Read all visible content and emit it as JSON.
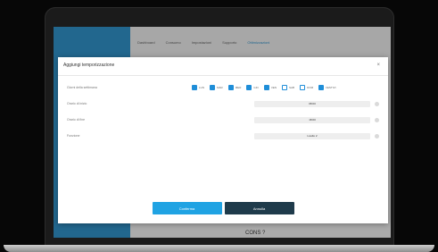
{
  "app": {
    "nav": [
      "Dashboard",
      "Consumo",
      "Impostazioni",
      "Supporto",
      "Ottimizzazioni"
    ],
    "active_nav": 4,
    "footer_text": "CONS ?"
  },
  "modal": {
    "title": "Aggiungi temporizzazione",
    "close_glyph": "×",
    "days_label": "Giorni della settimana",
    "days": [
      {
        "label": "LUN",
        "checked": true
      },
      {
        "label": "MAR",
        "checked": true
      },
      {
        "label": "MER",
        "checked": true
      },
      {
        "label": "GIO",
        "checked": true
      },
      {
        "label": "VEN",
        "checked": true
      },
      {
        "label": "SAB",
        "checked": false
      },
      {
        "label": "DOM",
        "checked": false
      },
      {
        "label": "FESTIVI",
        "checked": true
      }
    ],
    "fields": [
      {
        "label": "Orario di inizio",
        "value": "08:00"
      },
      {
        "label": "Orario di fine",
        "value": "18:00"
      },
      {
        "label": "Funzione",
        "value": "Livello 2"
      }
    ],
    "buttons": {
      "confirm": "Conferma",
      "cancel": "Annulla"
    }
  },
  "colors": {
    "accent": "#20a3e3",
    "sidebar": "#2c84b7",
    "secondary_button": "#1f3b4b"
  }
}
